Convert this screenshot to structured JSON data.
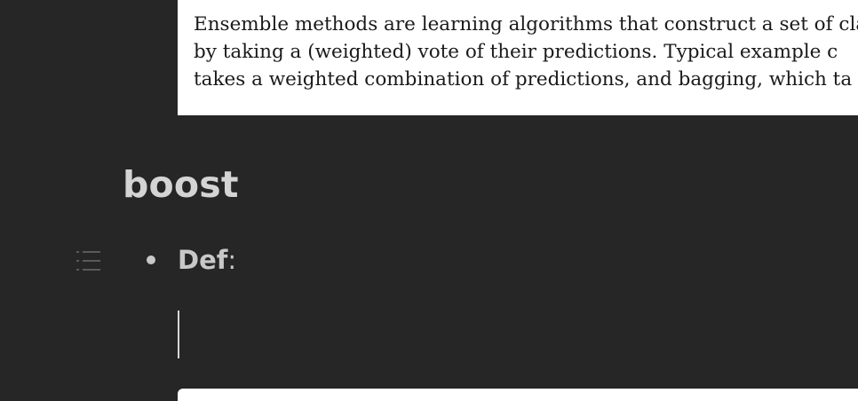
{
  "embedded_excerpt": {
    "lines": [
      "Ensemble methods are learning algorithms that construct a set of cla",
      "by taking a (weighted) vote of their predictions. Typical example c",
      "takes a weighted combination of predictions, and bagging, which ta"
    ]
  },
  "heading": {
    "text": "boost"
  },
  "bullet": {
    "label": "Def",
    "suffix": ":"
  },
  "icons": {
    "block_handle": "list-outline-icon"
  },
  "colors": {
    "background": "#262626",
    "heading_text": "#d4d4d4",
    "body_text": "#c8c8c8",
    "embed_background": "#ffffff"
  }
}
